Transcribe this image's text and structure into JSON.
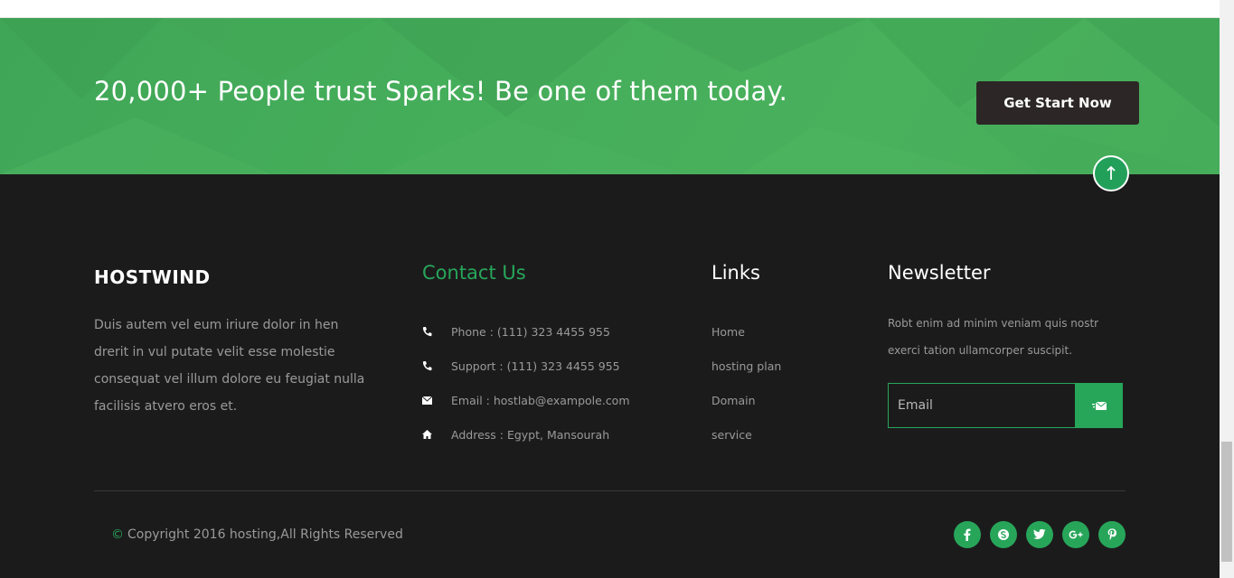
{
  "cta": {
    "title": "20,000+ People trust Sparks! Be one of them today.",
    "button_label": "Get Start Now"
  },
  "brand": {
    "name": "HOSTWIND"
  },
  "about": {
    "text": "Duis autem vel eum iriure dolor in hen drerit in vul putate velit esse molestie consequat vel illum dolore eu feugiat nulla facilisis atvero eros et."
  },
  "contact": {
    "title": "Contact Us",
    "items": [
      {
        "icon": "phone-icon",
        "text": "Phone : (111) 323 4455 955"
      },
      {
        "icon": "phone-icon",
        "text": "Support : (111) 323 4455 955"
      },
      {
        "icon": "envelope-icon",
        "text": "Email : hostlab@exampole.com"
      },
      {
        "icon": "home-icon",
        "text": "Address : Egypt, Mansourah"
      }
    ]
  },
  "links": {
    "title": "Links",
    "items": [
      "Home",
      "hosting plan",
      "Domain",
      "service"
    ]
  },
  "newsletter": {
    "title": "Newsletter",
    "text": "Robt enim ad minim veniam quis nostr exerci tation ullamcorper suscipit.",
    "input_placeholder": "Email"
  },
  "copyright": {
    "symbol": "©",
    "text": "Copyright 2016 hosting,All Rights Reserved"
  },
  "socials": [
    "facebook-icon",
    "skype-icon",
    "twitter-icon",
    "google-plus-icon",
    "pinterest-icon"
  ],
  "colors": {
    "accent": "#27a65a",
    "cta_bg": "#45ae5a",
    "footer_bg": "#1c1b1c",
    "button_dark": "#2c2626"
  }
}
